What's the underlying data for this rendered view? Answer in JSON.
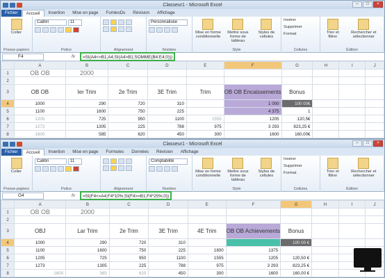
{
  "windows": [
    {
      "title": "Classeur1 - Microsoft Excel",
      "tabs": [
        "Fichier",
        "Accueil",
        "Insertion",
        "Mise en page",
        "FomlesDs",
        "Révision",
        "Affichage"
      ],
      "ribbon": {
        "paste": "Coller",
        "clipboard": "Presse-papiers",
        "font_name": "Calibri",
        "font_size": "11",
        "font_group": "Police",
        "align_group": "Alignement",
        "number_format": "Personnalisée",
        "number_group": "Nombre",
        "cond_format": "Mise en forme conditionnelle",
        "table_format": "Mettre sous forme de tableau",
        "cell_styles": "Styles de cellules",
        "style_group": "Style",
        "insert": "Insérer",
        "delete": "Supprimer",
        "format": "Format",
        "cells_group": "Cellules",
        "sort": "Trier et filtrer",
        "find": "Rechercher et sélectionner",
        "edit_group": "Édition"
      },
      "namebox": "F4",
      "formula": "=SI(A4<=B1;A4;SI(A4>B1;SOMME(B4:E4;0)))",
      "columns": [
        "A",
        "B",
        "C",
        "D",
        "E",
        "F",
        "G",
        "H",
        "I",
        "J"
      ],
      "rows": [
        {
          "n": "1",
          "cells": [
            "OB OB",
            "2000",
            "",
            "",
            "",
            "",
            "",
            "",
            "",
            ""
          ]
        },
        {
          "n": "2",
          "cells": [
            "",
            "",
            "",
            "",
            "",
            "",
            "",
            "",
            "",
            ""
          ]
        },
        {
          "n": "3",
          "cells": [
            "OB OB",
            "Ier Trim",
            "2e Trim",
            "3E Trim",
            "Trim",
            "OB OB Encaissements",
            "Bonus",
            "",
            "",
            ""
          ]
        },
        {
          "n": "4",
          "cells": [
            "1000",
            "290",
            "720",
            "310",
            "",
            "1 000",
            "100 00€",
            "",
            "",
            ""
          ]
        },
        {
          "n": "5",
          "cells": [
            "1100",
            "1600",
            "750",
            "225",
            "",
            "4 375",
            "1",
            "",
            "",
            ""
          ]
        },
        {
          "n": "6",
          "cells": [
            "1205",
            "725",
            "950",
            "1100",
            "1555",
            "1205",
            "120,5€",
            "",
            "",
            ""
          ]
        },
        {
          "n": "7",
          "cells": [
            "1273",
            "1305",
            "225",
            "788",
            "975",
            "3 293",
            "823,25 €",
            "",
            "",
            ""
          ]
        },
        {
          "n": "8",
          "cells": [
            "1600",
            "585",
            "620",
            "450",
            "300",
            "1600",
            "160,00€",
            "",
            "",
            ""
          ]
        },
        {
          "n": "9",
          "cells": [
            "",
            "",
            "",
            "",
            "",
            "",
            "",
            "",
            "",
            ""
          ]
        },
        {
          "n": "10",
          "cells": [
            "",
            "",
            "",
            "",
            "",
            "",
            "",
            "",
            "",
            ""
          ]
        }
      ]
    },
    {
      "title": "Classeur1 - Microsoft Excel",
      "tabs": [
        "Fichier",
        "Accueil",
        "Insertion",
        "Mise en page",
        "Formules",
        "Données",
        "Révision",
        "Affichage"
      ],
      "ribbon": {
        "paste": "Coller",
        "clipboard": "Presse-papiers",
        "font_name": "Calibri",
        "font_size": "11",
        "font_group": "Police",
        "align_group": "Alignement",
        "number_format": "Comptabilité",
        "number_group": "Nombre",
        "cond_format": "Mise en forme conditionnelle",
        "table_format": "Mettre sous forme de tableau",
        "cell_styles": "Styles de cellules",
        "style_group": "Style",
        "insert": "Insérer",
        "delete": "Supprimer",
        "format": "Format",
        "cells_group": "Cellules",
        "sort": "Trier et filtrer",
        "find": "Rechercher et sélectionner",
        "edit_group": "Édition"
      },
      "namebox": "G4",
      "formula": "=SI(F4<=A4;F4*10%;SI(F4>=B1;F4*25%;0))",
      "columns": [
        "A",
        "B",
        "C",
        "D",
        "E",
        "F",
        "G",
        "H",
        "I",
        "J"
      ],
      "rows": [
        {
          "n": "1",
          "cells": [
            "OB OB",
            "2000",
            "",
            "",
            "",
            "",
            "",
            "",
            "",
            ""
          ]
        },
        {
          "n": "2",
          "cells": [
            "",
            "",
            "",
            "",
            "",
            "",
            "",
            "",
            "",
            ""
          ]
        },
        {
          "n": "3",
          "cells": [
            "OBJ",
            "Lar Trim",
            "2e Trim",
            "3E Trim",
            "4E Trim",
            "OB OB Achievements",
            "Bonus",
            "",
            "",
            ""
          ]
        },
        {
          "n": "4",
          "cells": [
            "1000",
            "290",
            "720",
            "310",
            "",
            "",
            "100 00 €",
            "",
            "",
            ""
          ]
        },
        {
          "n": "5",
          "cells": [
            "1100",
            "1600",
            "750",
            "225",
            "1800",
            "1375",
            "",
            "",
            "",
            ""
          ]
        },
        {
          "n": "6",
          "cells": [
            "1205",
            "725",
            "950",
            "1100",
            "1555",
            "1205",
            "120,50 €",
            "",
            "",
            ""
          ]
        },
        {
          "n": "7",
          "cells": [
            "1273",
            "1305",
            "225",
            "788",
            "975",
            "3 293",
            "823,25 €",
            "",
            "",
            ""
          ]
        },
        {
          "n": "8",
          "cells": [
            "1600",
            "365",
            "620",
            "450",
            "300",
            "1600",
            "160,00 €",
            "",
            "",
            ""
          ]
        },
        {
          "n": "9",
          "cells": [
            "",
            "",
            "",
            "",
            "",
            "",
            "",
            "",
            "",
            ""
          ]
        }
      ]
    }
  ]
}
